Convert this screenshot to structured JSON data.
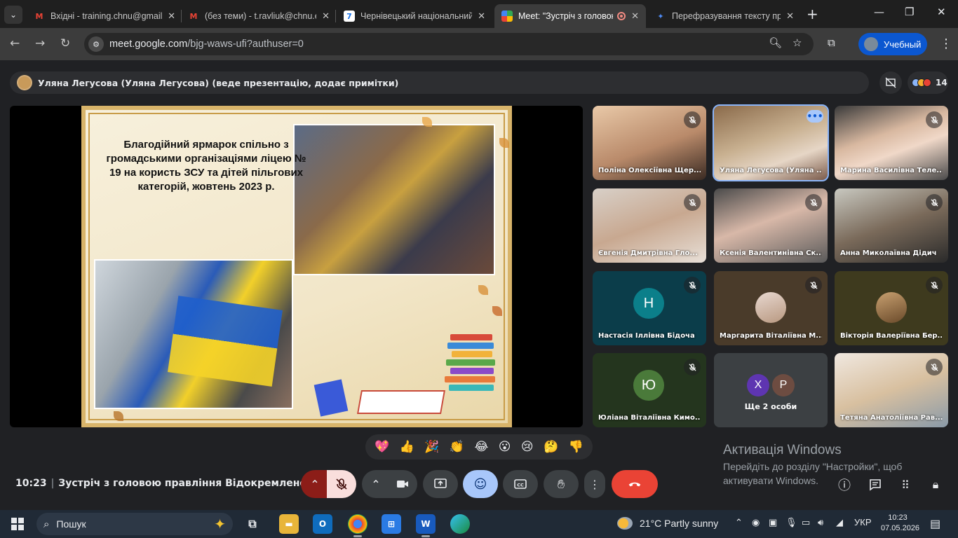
{
  "browser": {
    "tabs": [
      {
        "title": "Вхідні - training.chnu@gmail",
        "favicon": "gmail-icon",
        "fav_text": "M",
        "fav_color": "#ea4335"
      },
      {
        "title": "(без теми) - t.ravliuk@chnu.e",
        "favicon": "gmail-icon",
        "fav_text": "M",
        "fav_color": "#ea4335"
      },
      {
        "title": "Чернівецький національний у",
        "favicon": "calendar-icon",
        "fav_text": "7",
        "fav_color": "#1a73e8"
      },
      {
        "title": "Meet: \"Зустріч з головою",
        "favicon": "meet-icon",
        "fav_text": "",
        "fav_color": "#00897b",
        "active": true
      },
      {
        "title": "Перефразування тексту про",
        "favicon": "gemini-icon",
        "fav_text": "✦",
        "fav_color": "#4f8cf7"
      }
    ],
    "url_host": "meet.google.com",
    "url_path": "/bjg-waws-ufi?authuser=0",
    "profile_label": "Учебный"
  },
  "meet": {
    "presenter_text": "Уляна Легусова (Уляна Легусова) (веде презентацію, додає примітки)",
    "participant_count": "14",
    "slide": {
      "title": "Благодійний ярмарок спільно з громадськими організаціями ліцею № 19 на користь ЗСУ та дітей пільгових категорій, жовтень 2023 р."
    },
    "tiles": [
      {
        "name": "Поліна Олексіївна Щер...",
        "type": "video",
        "bg": "linear-gradient(160deg,#e9c9a8,#b98a6a 55%,#3a2a22)",
        "muted": true
      },
      {
        "name": "Уляна Легусова (Уляна ...",
        "type": "video",
        "bg": "linear-gradient(160deg,#8a6a4a,#c8b090 45%,#e6d6c6 70%,#7a5a4a)",
        "muted": false,
        "active_speaker": true
      },
      {
        "name": "Марина Василівна Теле...",
        "type": "video",
        "bg": "linear-gradient(160deg,#3a3a3a,#d8b8a0 40%,#f0d8c8 60%,#4a4a4a)",
        "muted": true
      },
      {
        "name": "Євгенія Дмитрівна Гло...",
        "type": "video",
        "bg": "linear-gradient(160deg,#d8d0c8,#c8a890 50%,#e8e0d8)",
        "muted": true
      },
      {
        "name": "Ксенія Валентинівна Ск...",
        "type": "video",
        "bg": "linear-gradient(160deg,#4a4a4a,#d8b8a8 45%,#5a5a5a)",
        "muted": true
      },
      {
        "name": "Анна Миколаївна Дідич",
        "type": "video",
        "bg": "linear-gradient(160deg,#c8c8c0,#7a6a5a 50%,#2a2a2a)",
        "muted": true
      },
      {
        "name": "Настасія Іллівна Бідоча",
        "type": "letter",
        "letter": "Н",
        "tile_bg": "#0b3d4a",
        "av_bg": "#0b7f8a",
        "muted": true
      },
      {
        "name": "Маргарита Віталіївна М...",
        "type": "photo",
        "tile_bg": "#4a3b2a",
        "av_bg": "linear-gradient(160deg,#e8d8d0,#b89880)",
        "muted": true
      },
      {
        "name": "Вікторія Валеріївна Бер...",
        "type": "photo",
        "tile_bg": "#3e3a1e",
        "av_bg": "linear-gradient(160deg,#c8a070,#6a4a2a)",
        "muted": true
      },
      {
        "name": "Юліана Віталіївна Кимо...",
        "type": "letter",
        "letter": "Ю",
        "tile_bg": "#24351e",
        "av_bg": "#4a7a3a",
        "muted": true
      },
      {
        "name": "Ще 2 особи",
        "type": "others",
        "tile_bg": "#3c4043",
        "others": [
          {
            "letter": "Х",
            "bg": "#5e35b1"
          },
          {
            "letter": "Р",
            "bg": "#6d4c41"
          }
        ]
      },
      {
        "name": "Тетяна Анатоліївна Рав...",
        "type": "video",
        "bg": "linear-gradient(160deg,#f0e8e0,#d8c0a0 50%,#8a9aa8)",
        "muted": true
      }
    ],
    "reactions": [
      "💖",
      "👍",
      "🎉",
      "👏",
      "😂",
      "😮",
      "😢",
      "🤔",
      "👎"
    ],
    "time": "10:23",
    "meeting_title": "Зустріч з головою правління Відокремленого..."
  },
  "windows": {
    "activation_title": "Активація Windows",
    "activation_text": "Перейдіть до розділу \"Настройки\", щоб активувати Windows.",
    "search_placeholder": "Пошук",
    "weather": "21°C  Partly sunny",
    "lang": "УКР",
    "clock_time": "10:23",
    "clock_date": "07.05.2026"
  }
}
